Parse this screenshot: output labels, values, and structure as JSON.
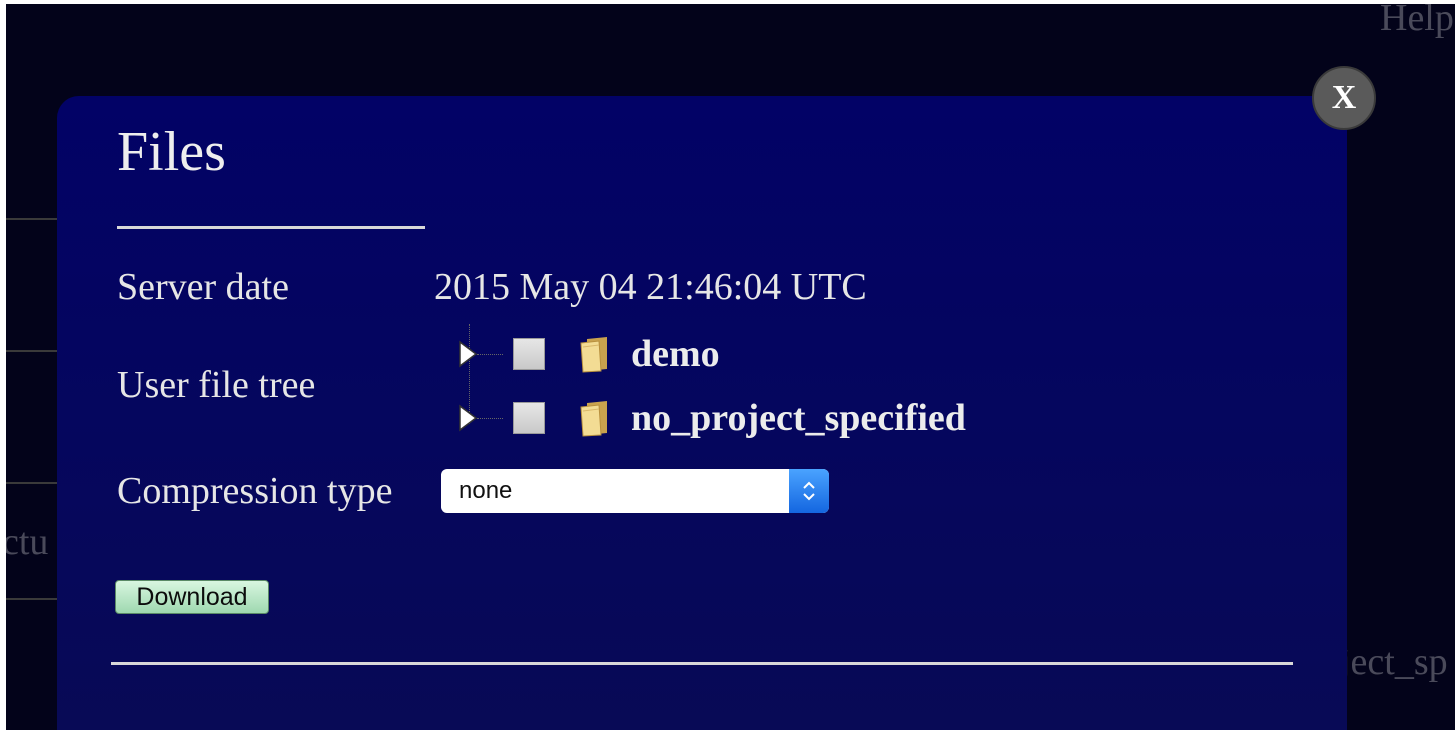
{
  "background": {
    "help_fragment": "Help",
    "left_fragment": "ctu",
    "right_fragment": "ject_sp"
  },
  "dialog": {
    "title": "Files",
    "close_label": "X",
    "server_date": {
      "label": "Server date",
      "value": "2015 May 04 21:46:04 UTC"
    },
    "file_tree": {
      "label": "User file tree",
      "nodes": [
        {
          "name": "demo",
          "icon": "folder-icon",
          "checked": false,
          "expanded": false
        },
        {
          "name": "no_project_specified",
          "icon": "folder-icon",
          "checked": false,
          "expanded": false
        }
      ]
    },
    "compression": {
      "label": "Compression type",
      "selected": "none"
    },
    "download_label": "Download"
  },
  "colors": {
    "dialog_background": "#020266",
    "page_background": "#03031a",
    "download_button": "#b8e8c4",
    "select_arrow": "#2a80f0",
    "close_button": "#5a5a5a"
  }
}
